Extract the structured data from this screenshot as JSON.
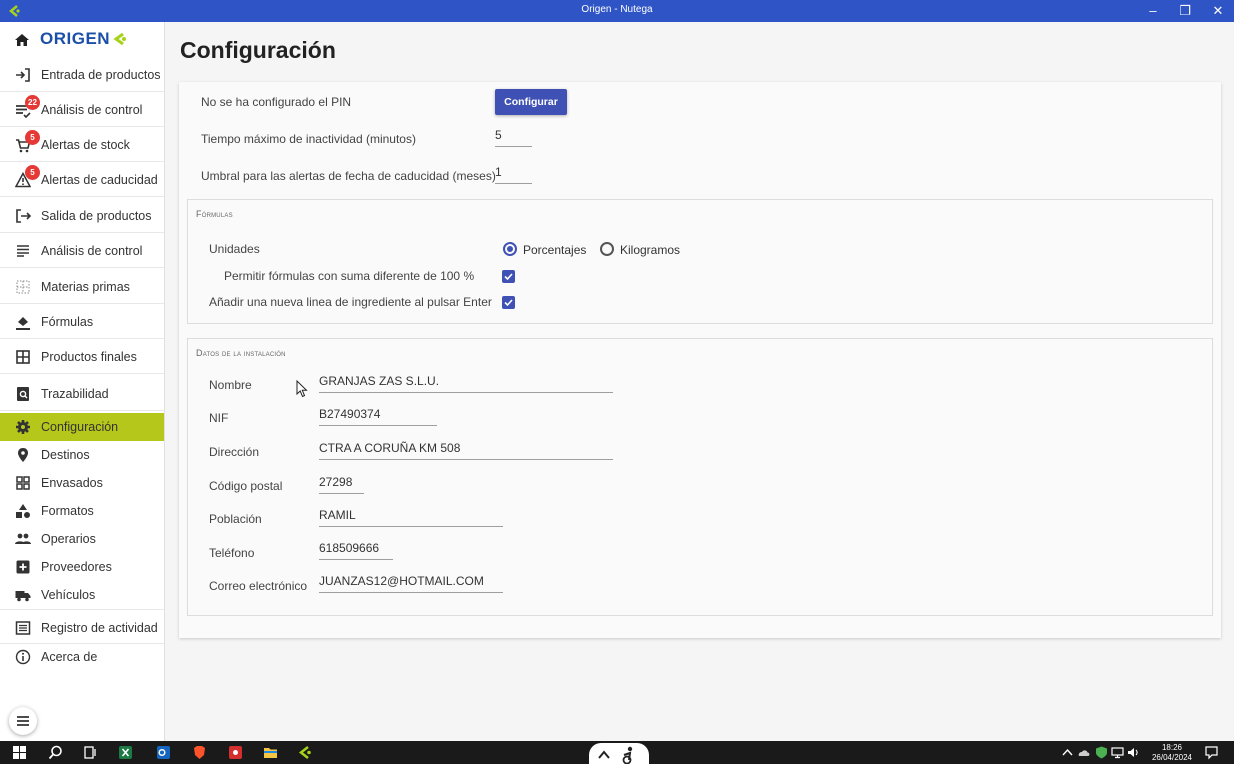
{
  "window": {
    "title": "Origen - Nutega"
  },
  "sidebar": {
    "brand": "ORIGEN",
    "items": [
      {
        "label": "Entrada de productos"
      },
      {
        "label": "Análisis de control",
        "badge": "22"
      },
      {
        "label": "Alertas de stock",
        "badge": "5"
      },
      {
        "label": "Alertas de caducidad",
        "badge": "5"
      },
      {
        "label": "Salida de productos"
      },
      {
        "label": "Análisis de control"
      },
      {
        "label": "Materias primas"
      },
      {
        "label": "Fórmulas"
      },
      {
        "label": "Productos finales"
      },
      {
        "label": "Trazabilidad"
      },
      {
        "label": "Configuración"
      },
      {
        "label": "Destinos"
      },
      {
        "label": "Envasados"
      },
      {
        "label": "Formatos"
      },
      {
        "label": "Operarios"
      },
      {
        "label": "Proveedores"
      },
      {
        "label": "Vehículos"
      },
      {
        "label": "Registro de actividad"
      },
      {
        "label": "Acerca de"
      }
    ],
    "active_index": 10
  },
  "main": {
    "title": "Configuración",
    "pin_label": "No se ha configurado el PIN",
    "pin_button": "Configurar",
    "inactivity_label": "Tiempo máximo de inactividad (minutos)",
    "inactivity_value": "5",
    "expiry_label": "Umbral para las alertas de fecha de caducidad (meses)",
    "expiry_value": "1"
  },
  "formulas": {
    "legend": "Fórmulas",
    "units_label": "Unidades",
    "units_options": [
      "Porcentajes",
      "Kilogramos"
    ],
    "units_selected": "Porcentajes",
    "allow_sum_label": "Permitir fórmulas con suma diferente de 100 %",
    "allow_sum_checked": true,
    "enter_line_label": "Añadir una nueva linea de ingrediente al pulsar Enter",
    "enter_line_checked": true
  },
  "installation": {
    "legend": "Datos de la instalación",
    "fields": [
      {
        "label": "Nombre",
        "value": "GRANJAS ZAS S.L.U."
      },
      {
        "label": "NIF",
        "value": "B27490374"
      },
      {
        "label": "Dirección",
        "value": "CTRA A CORUÑA KM 508"
      },
      {
        "label": "Código postal",
        "value": "27298"
      },
      {
        "label": "Población",
        "value": "RAMIL"
      },
      {
        "label": "Teléfono",
        "value": "618509666"
      },
      {
        "label": "Correo electrónico",
        "value": "JUANZAS12@HOTMAIL.COM"
      }
    ]
  },
  "taskbar": {
    "time": "18:26",
    "date": "26/04/2024"
  }
}
